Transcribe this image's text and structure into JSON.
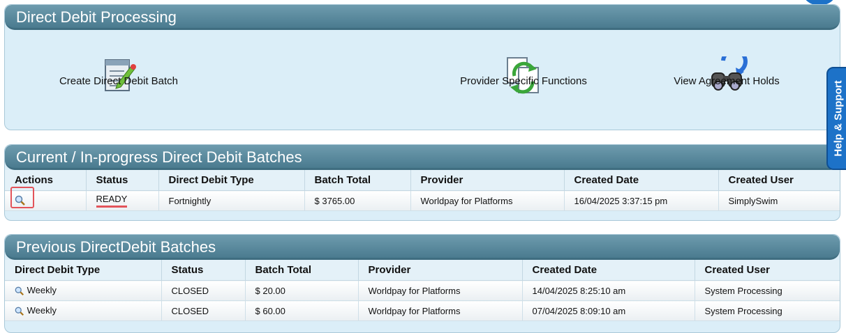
{
  "direct_debit": {
    "title": "Direct Debit Processing",
    "actions": [
      {
        "label": "Create Direct Debit Batch",
        "icon": "edit-document-icon"
      },
      {
        "label": "Provider Specific Functions",
        "icon": "refresh-document-icon"
      },
      {
        "label": "View Agreement Holds",
        "icon": "binoculars-icon"
      }
    ]
  },
  "current_batches": {
    "title": "Current / In-progress Direct Debit Batches",
    "columns": [
      "Actions",
      "Status",
      "Direct Debit Type",
      "Batch Total",
      "Provider",
      "Created Date",
      "Created User"
    ],
    "rows": [
      {
        "status": "READY",
        "type": "Fortnightly",
        "total": "$ 3765.00",
        "provider": "Worldpay for Platforms",
        "created_date": "16/04/2025 3:37:15 pm",
        "created_user": "SimplySwim"
      }
    ]
  },
  "previous_batches": {
    "title": "Previous DirectDebit Batches",
    "columns": [
      "Direct Debit Type",
      "Status",
      "Batch Total",
      "Provider",
      "Created Date",
      "Created User"
    ],
    "rows": [
      {
        "type": "Weekly",
        "status": "CLOSED",
        "total": "$ 20.00",
        "provider": "Worldpay for Platforms",
        "created_date": "14/04/2025 8:25:10 am",
        "created_user": "System Processing"
      },
      {
        "type": "Weekly",
        "status": "CLOSED",
        "total": "$ 60.00",
        "provider": "Worldpay for Platforms",
        "created_date": "07/04/2025 8:09:10 am",
        "created_user": "System Processing"
      }
    ]
  },
  "help_tab": {
    "label": "Help & Support"
  },
  "colors": {
    "header": "#4a7b8f",
    "panel": "#dbeef8",
    "highlight": "#e3545a",
    "help": "#1d72c8"
  }
}
